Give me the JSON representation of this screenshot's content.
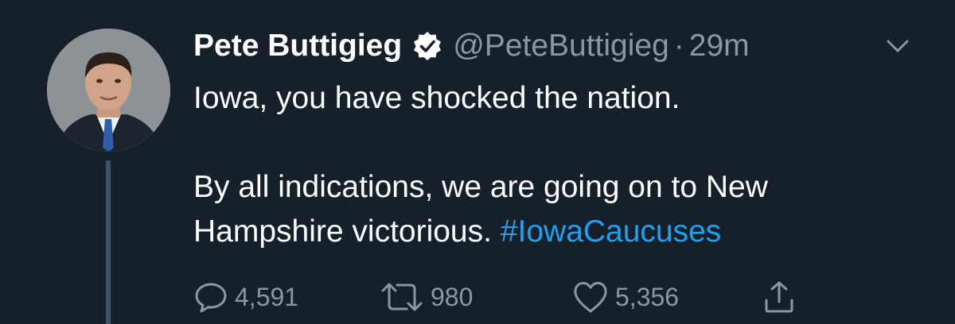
{
  "author": {
    "name": "Pete Buttigieg",
    "handle": "@PeteButtigieg",
    "separator": "·",
    "time": "29m",
    "verified_icon": "verified-badge-icon",
    "avatar": "avatar"
  },
  "tweet": {
    "line1": "Iowa, you have shocked the nation.",
    "line2": "By all indications, we are going on to New",
    "line3": "Hampshire victorious.",
    "hashtag": "#IowaCaucuses"
  },
  "actions": {
    "replies": "4,591",
    "retweets": "980",
    "likes": "5,356"
  },
  "colors": {
    "background": "#15202b",
    "primary_text": "#ffffff",
    "secondary_text": "#8899a6",
    "link": "#1da1f2",
    "thread_line": "#3d5466"
  },
  "icons": [
    "reply-icon",
    "retweet-icon",
    "like-icon",
    "share-icon",
    "chevron-down-icon",
    "verified-badge-icon"
  ]
}
